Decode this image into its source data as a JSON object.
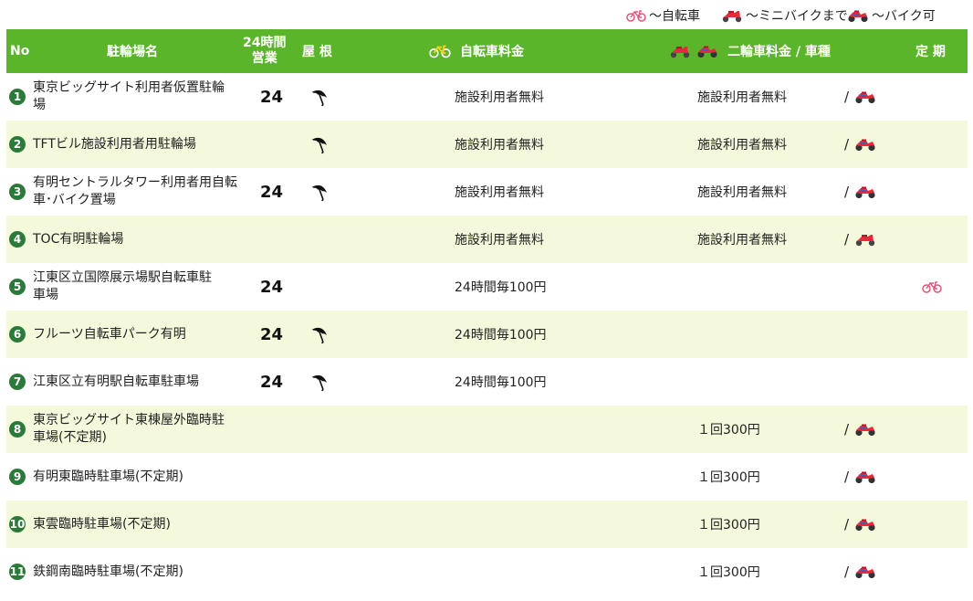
{
  "legend": {
    "bicycle": "～自転車",
    "minibike": "～ミニバイクまで",
    "motorbike": "～バイク可"
  },
  "header": {
    "no": "No",
    "name": "駐輪場名",
    "hours_line1": "24時間",
    "hours_line2": "営業",
    "roof": "屋 根",
    "bike_fee": "自転車料金",
    "moto_fee": "二輪車料金 / 車種",
    "pass": "定 期"
  },
  "rows": [
    {
      "no": "1",
      "name_line1": "東京ビッグサイト利用者仮置駐輪",
      "name_line2": "場",
      "hours": "24",
      "roof": true,
      "bike_fee": "施設利用者無料",
      "moto_fee": "施設利用者無料",
      "moto_type": "motorbike",
      "pass": ""
    },
    {
      "no": "2",
      "name_line1": "TFTビル施設利用者用駐輪場",
      "name_line2": "",
      "hours": "",
      "roof": true,
      "bike_fee": "施設利用者無料",
      "moto_fee": "施設利用者無料",
      "moto_type": "motorbike",
      "pass": ""
    },
    {
      "no": "3",
      "name_line1": "有明セントラルタワー利用者用自転",
      "name_line2": "車･バイク置場",
      "hours": "24",
      "roof": true,
      "bike_fee": "施設利用者無料",
      "moto_fee": "施設利用者無料",
      "moto_type": "motorbike",
      "pass": ""
    },
    {
      "no": "4",
      "name_line1": "TOC有明駐輪場",
      "name_line2": "",
      "hours": "",
      "roof": false,
      "bike_fee": "施設利用者無料",
      "moto_fee": "施設利用者無料",
      "moto_type": "minibike",
      "pass": ""
    },
    {
      "no": "5",
      "name_line1": "江東区立国際展示場駅自転車駐",
      "name_line2": "車場",
      "hours": "24",
      "roof": false,
      "bike_fee": "24時間毎100円",
      "moto_fee": "",
      "moto_type": "",
      "pass": "bicycle"
    },
    {
      "no": "6",
      "name_line1": "フルーツ自転車パーク有明",
      "name_line2": "",
      "hours": "24",
      "roof": true,
      "bike_fee": "24時間毎100円",
      "moto_fee": "",
      "moto_type": "",
      "pass": ""
    },
    {
      "no": "7",
      "name_line1": "江東区立有明駅自転車駐車場",
      "name_line2": "",
      "hours": "24",
      "roof": true,
      "bike_fee": "24時間毎100円",
      "moto_fee": "",
      "moto_type": "",
      "pass": ""
    },
    {
      "no": "8",
      "name_line1": "東京ビッグサイト東棟屋外臨時駐",
      "name_line2": "車場(不定期)",
      "hours": "",
      "roof": false,
      "bike_fee": "",
      "moto_fee": "１回300円",
      "moto_type": "motorbike",
      "pass": ""
    },
    {
      "no": "9",
      "name_line1": "有明東臨時駐車場(不定期)",
      "name_line2": "",
      "hours": "",
      "roof": false,
      "bike_fee": "",
      "moto_fee": "１回300円",
      "moto_type": "motorbike",
      "pass": ""
    },
    {
      "no": "10",
      "name_line1": "東雲臨時駐車場(不定期)",
      "name_line2": "",
      "hours": "",
      "roof": false,
      "bike_fee": "",
      "moto_fee": "１回300円",
      "moto_type": "motorbike",
      "pass": ""
    },
    {
      "no": "11",
      "name_line1": "鉄鋼南臨時駐車場(不定期)",
      "name_line2": "",
      "hours": "",
      "roof": false,
      "bike_fee": "",
      "moto_fee": "１回300円",
      "moto_type": "motorbike",
      "pass": ""
    }
  ],
  "colors": {
    "header_bg": "#5ab52a",
    "alt_row_bg": "#f5f9dc",
    "number_badge": "#2c7a3a",
    "bicycle_icon": "#e0567a",
    "bike_icon": "#d9263c"
  }
}
